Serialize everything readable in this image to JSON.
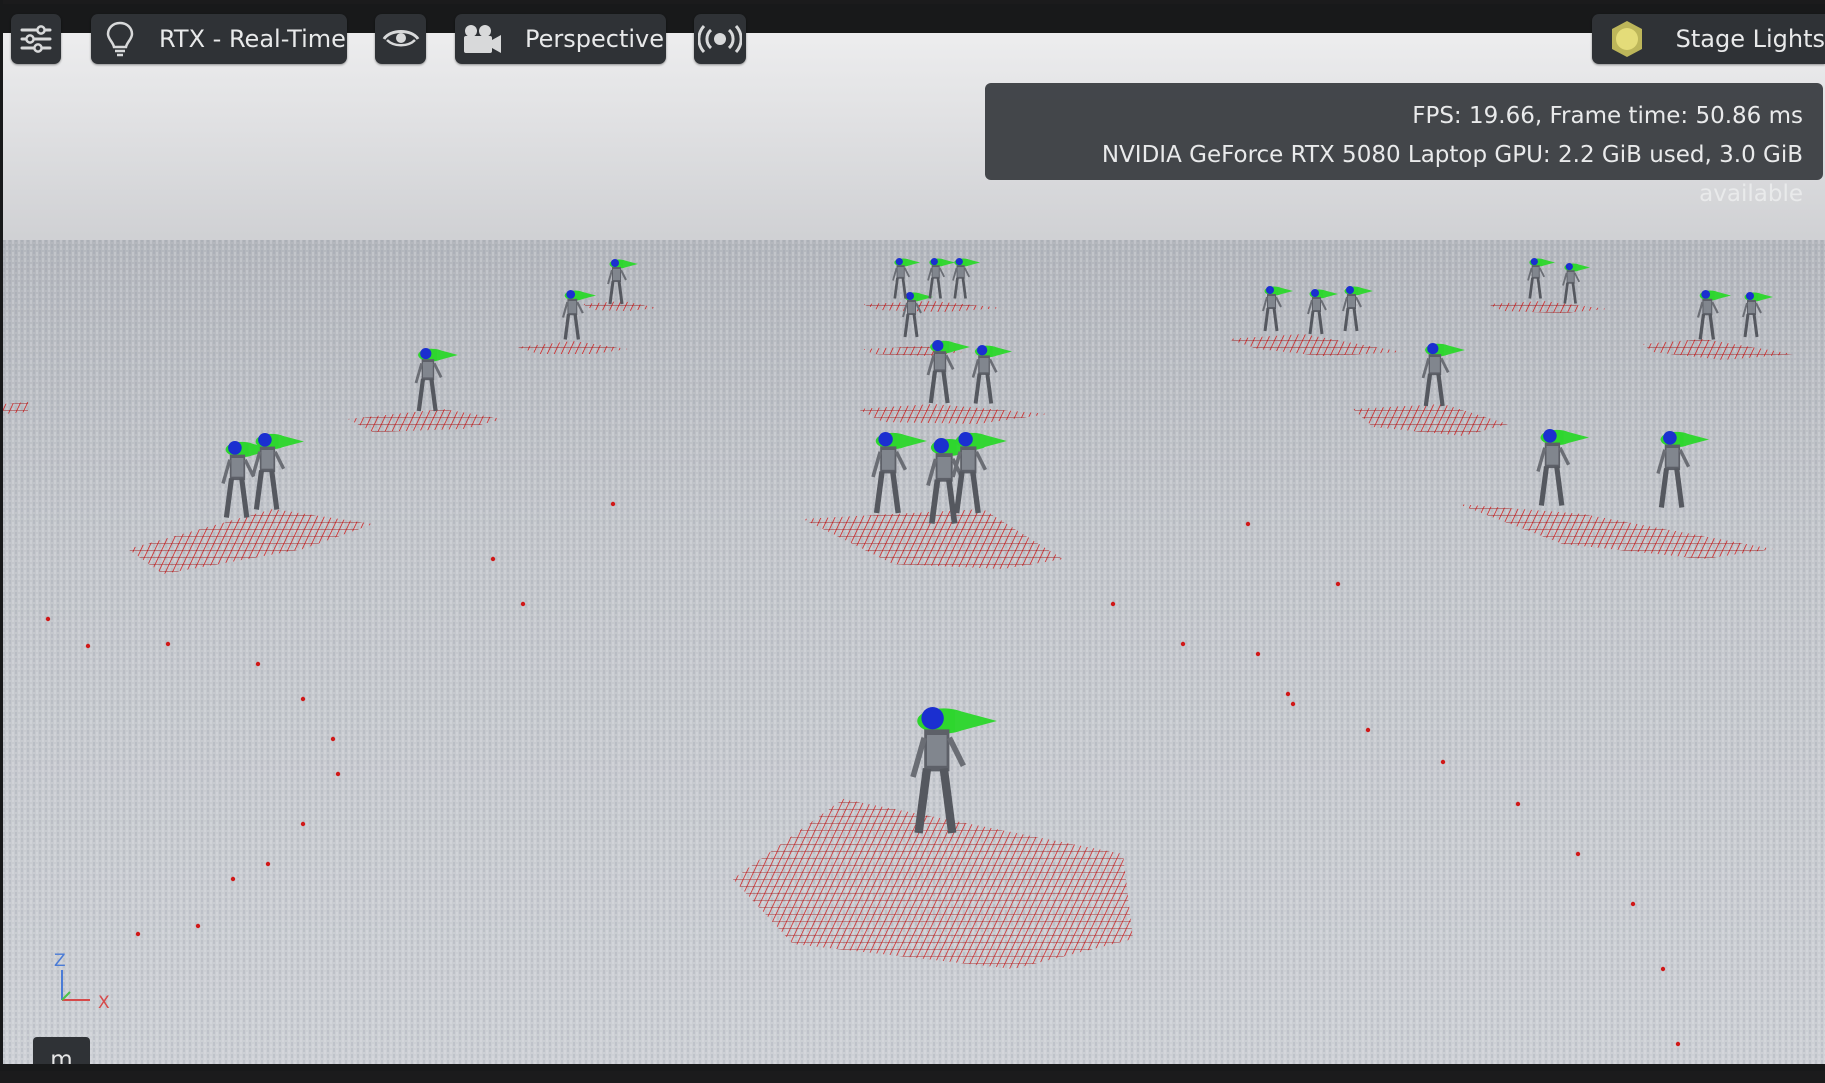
{
  "toolbar": {
    "settings_icon": "sliders-icon",
    "render_mode": {
      "icon": "lightbulb-icon",
      "label": "RTX - Real-Time"
    },
    "visibility_icon": "eye-icon",
    "camera": {
      "icon": "camera-icon",
      "label": "Perspective"
    },
    "broadcast_icon": "broadcast-icon",
    "lighting": {
      "icon": "sun-icon",
      "label": "Stage Lights",
      "icon_color": "#c9c26a"
    }
  },
  "stats": {
    "fps_line": "FPS: 19.66, Frame time: 50.86 ms",
    "gpu_line": "NVIDIA GeForce RTX 5080 Laptop GPU: 2.2 GiB used, 3.0 GiB available"
  },
  "axis_gizmo": {
    "z_label": "Z",
    "x_label": "X"
  },
  "units_tab": {
    "label": "m"
  },
  "colors": {
    "robot_head_green": "#33d633",
    "robot_head_blue": "#1a2fd6",
    "footprint_red": "#d21a1a",
    "toolbar_bg": "#2f3236"
  }
}
